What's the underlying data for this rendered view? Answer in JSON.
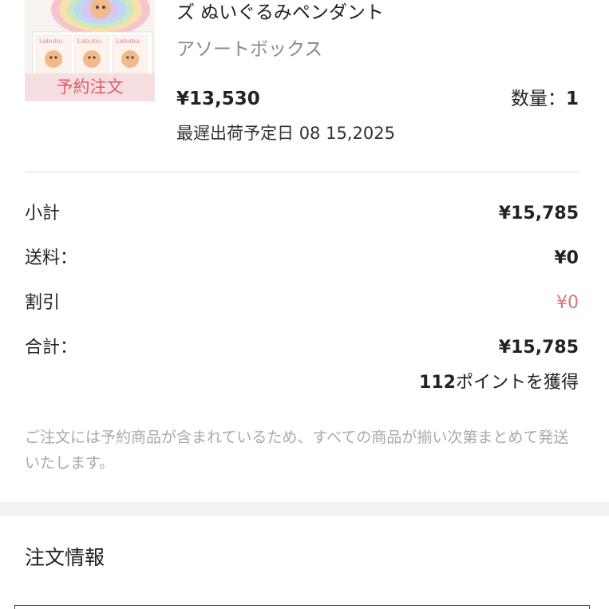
{
  "product": {
    "name": "ズ ぬいぐるみペンダント",
    "variant": "アソートボックス",
    "price": "¥13,530",
    "quantity_label": "数量：",
    "quantity_value": "1",
    "ship_date_label": "最遅出荷予定日",
    "ship_date_value": "08 15,2025",
    "badge": "予約注文",
    "image_alt": "plush-pendant-box-image"
  },
  "summary": {
    "subtotal_label": "小計",
    "subtotal_value": "¥15,785",
    "shipping_label": "送料：",
    "shipping_value": "¥0",
    "discount_label": "割引",
    "discount_value": "¥0",
    "total_label": "合計：",
    "total_value": "¥15,785",
    "points_value": "112",
    "points_text": "ポイントを獲得"
  },
  "notice": "ご注文には予約商品が含まれているため、すべての商品が揃い次第まとめて発送いたします。",
  "order_info": {
    "title": "注文情報"
  },
  "colors": {
    "discount": "#d9737f",
    "badge_text": "#e05a6a",
    "muted": "#a9a9a9"
  }
}
